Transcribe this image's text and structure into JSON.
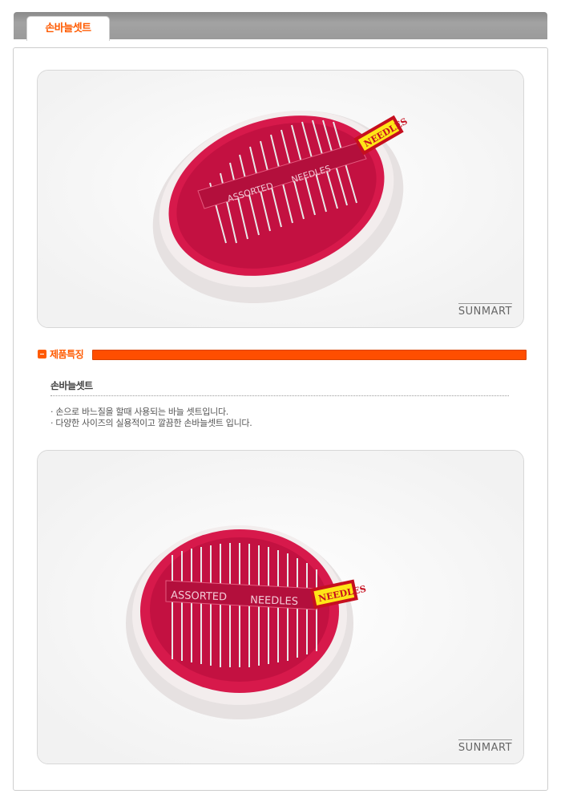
{
  "tab": {
    "label": "손바늘셋트"
  },
  "photo_top": {
    "brand": "SUNMART",
    "box_text": [
      "ASSORTED",
      "NEEDLES"
    ],
    "tag": "NEEDLES"
  },
  "section": {
    "label": "제품특징"
  },
  "product": {
    "name": "손바늘셋트",
    "lines": [
      "· 손으로 바느질을 할때 사용되는 바늘 셋트입니다.",
      "· 다양한 사이즈의 실용적이고 깔끔한 손바늘셋트 입니다."
    ]
  },
  "photo_bottom": {
    "brand": "SUNMART",
    "box_text": [
      "ASSORTED",
      "NEEDLES"
    ],
    "tag": "NEEDLES"
  },
  "colors": {
    "accent": "#ff5a00",
    "case": "#d7194b"
  }
}
